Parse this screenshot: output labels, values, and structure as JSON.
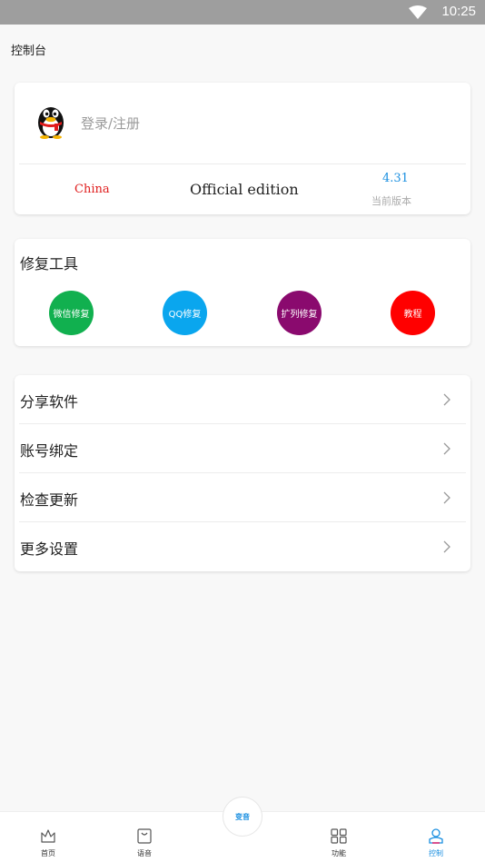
{
  "status_bar": {
    "time": "10:25",
    "wifi_icon": "wifi-icon"
  },
  "app_bar": {
    "title": "控制台"
  },
  "user_card": {
    "avatar_icon": "qq-penguin-icon",
    "login_text": "登录/注册",
    "region": "China",
    "edition": "Official edition",
    "version": "4.31",
    "version_label": "当前版本"
  },
  "tools": {
    "title": "修复工具",
    "buttons": [
      {
        "label": "微信修复",
        "color": "#11b04f"
      },
      {
        "label": "QQ修复",
        "color": "#0aa6ee"
      },
      {
        "label": "扩列修复",
        "color": "#8a0a6e"
      },
      {
        "label": "教程",
        "color": "#ff0000"
      }
    ]
  },
  "menu": {
    "items": [
      {
        "label": "分享软件"
      },
      {
        "label": "账号绑定"
      },
      {
        "label": "检查更新"
      },
      {
        "label": "更多设置"
      }
    ]
  },
  "tab_bar": {
    "center_label": "变音",
    "tabs": [
      {
        "label": "首页",
        "icon": "crown-icon"
      },
      {
        "label": "语音",
        "icon": "bag-icon"
      },
      {
        "label": "功能",
        "icon": "grid-icon"
      },
      {
        "label": "控制",
        "icon": "user-icon"
      }
    ],
    "active": "控制",
    "accent": "#1a8fe0"
  }
}
